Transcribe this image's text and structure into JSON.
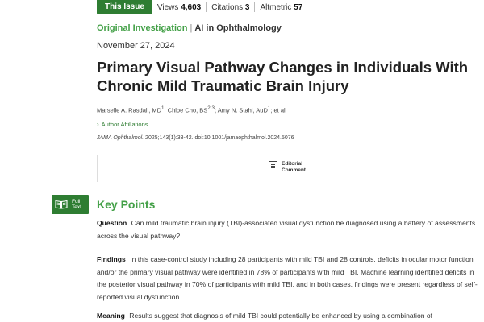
{
  "topbar": {
    "issue_label": "This Issue",
    "views_label": "Views",
    "views_value": "4,603",
    "citations_label": "Citations",
    "citations_value": "3",
    "altmetric_label": "Altmetric",
    "altmetric_value": "57",
    "accent": "#2e7d32"
  },
  "article": {
    "type": "Original Investigation",
    "separator": "|",
    "topic": "AI in Ophthalmology",
    "date": "November 27, 2024",
    "title": "Primary Visual Pathway Changes in Individuals With Chronic Mild Traumatic Brain Injury",
    "authors_text": "Marselle A. Rasdall, MD",
    "authors_sup1": "1",
    "authors_2": "; Chloe Cho, BS",
    "authors_sup2": "2,3",
    "authors_3": "; Amy N. Stahl, AuD",
    "authors_sup3": "1",
    "authors_4": "; ",
    "authors_etal": "et al",
    "affiliations_label": "Author Affiliations",
    "citation_journal": "JAMA Ophthalmol.",
    "citation_rest": " 2025;143(1):33-42. doi:10.1001/jamaophthalmol.2024.5076"
  },
  "editorial": {
    "line1": "Editorial",
    "line2": "Comment",
    "icon": "document-icon"
  },
  "fulltext": {
    "line1": "Full",
    "line2": "Text",
    "icon": "book-icon"
  },
  "key_points": {
    "title": "Key Points",
    "question_label": "Question",
    "question_text": "Can mild traumatic brain injury (TBI)-associated visual dysfunction be diagnosed using a battery of assessments across the visual pathway?",
    "findings_label": "Findings",
    "findings_text": "In this case-control study including 28 participants with mild TBI and 28 controls, deficits in ocular motor function and/or the primary visual pathway were identified in 78% of participants with mild TBI. Machine learning identified deficits in the posterior visual pathway in 70% of participants with mild TBI, and in both cases, findings were present regardless of self-reported visual dysfunction.",
    "meaning_label": "Meaning",
    "meaning_text": "Results suggest that diagnosis of mild TBI could potentially be enhanced by using a combination of"
  }
}
